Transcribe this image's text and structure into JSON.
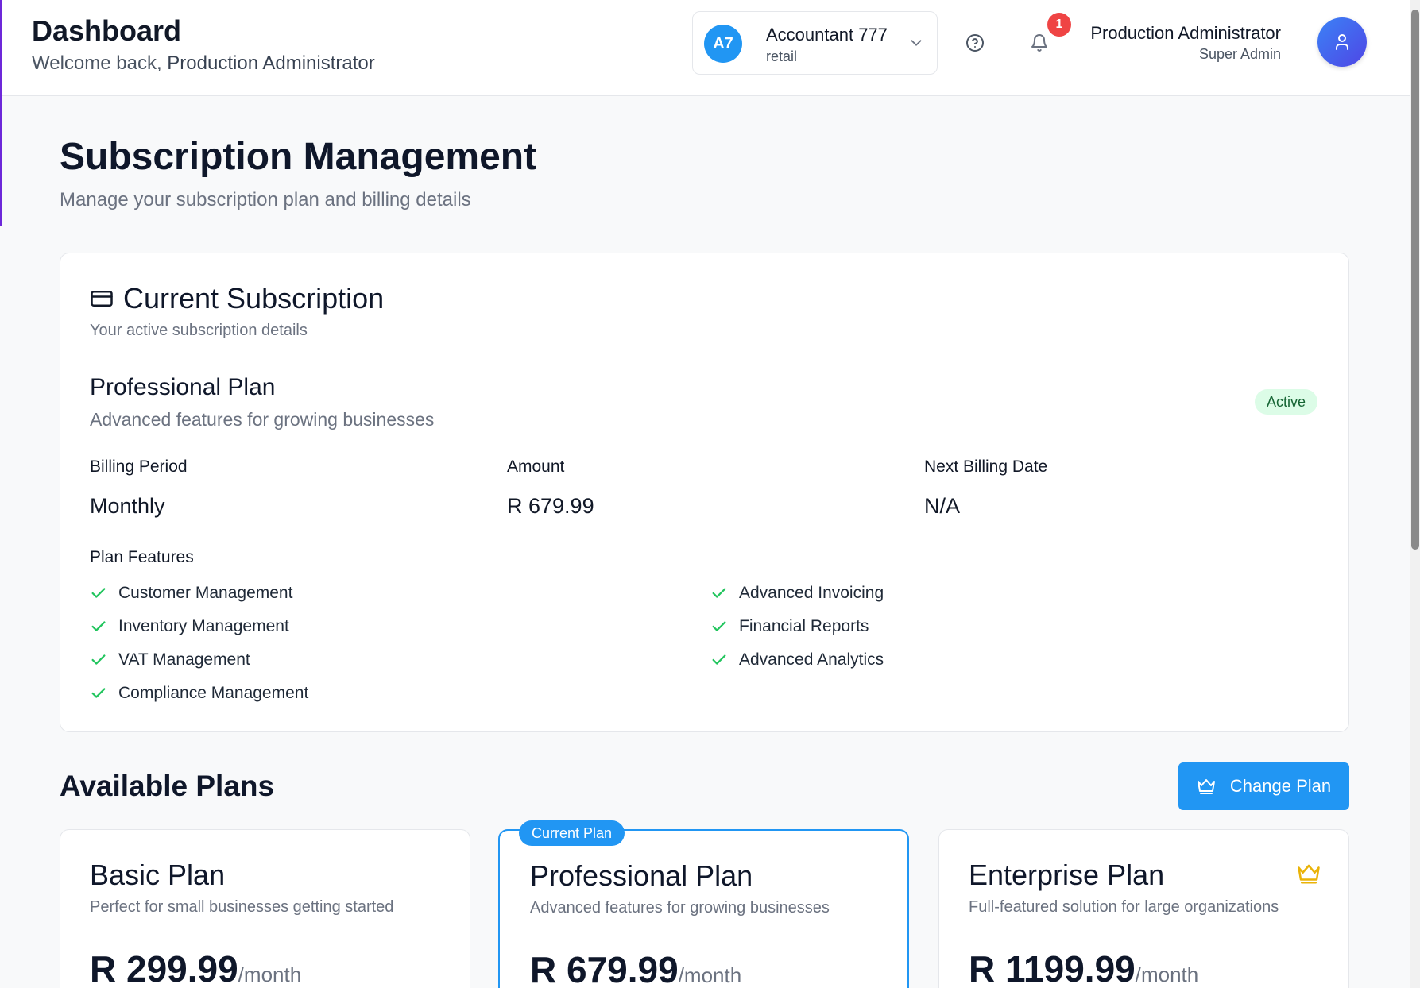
{
  "header": {
    "title": "Dashboard",
    "welcome_prefix": "Welcome back,",
    "welcome_name": "Production Administrator",
    "company": {
      "initials": "A7",
      "name": "Accountant 777",
      "type": "retail"
    },
    "notifications_count": "1",
    "user": {
      "name": "Production Administrator",
      "role": "Super Admin"
    }
  },
  "page": {
    "title": "Subscription Management",
    "subtitle": "Manage your subscription plan and billing details"
  },
  "current_subscription": {
    "title": "Current Subscription",
    "description": "Your active subscription details",
    "plan_name": "Professional Plan",
    "plan_description": "Advanced features for growing businesses",
    "status": "Active",
    "billing_period_label": "Billing Period",
    "billing_period_value": "Monthly",
    "amount_label": "Amount",
    "amount_value": "R 679.99",
    "next_billing_label": "Next Billing Date",
    "next_billing_value": "N/A",
    "features_label": "Plan Features",
    "features": [
      "Customer Management",
      "Inventory Management",
      "VAT Management",
      "Compliance Management",
      "Advanced Invoicing",
      "Financial Reports",
      "Advanced Analytics"
    ]
  },
  "available_plans": {
    "title": "Available Plans",
    "change_button": "Change Plan",
    "current_tag": "Current Plan",
    "plans": [
      {
        "name": "Basic Plan",
        "description": "Perfect for small businesses getting started",
        "price": "R 299.99",
        "period": "/month"
      },
      {
        "name": "Professional Plan",
        "description": "Advanced features for growing businesses",
        "price": "R 679.99",
        "period": "/month"
      },
      {
        "name": "Enterprise Plan",
        "description": "Full-featured solution for large organizations",
        "price": "R 1199.99",
        "period": "/month"
      }
    ]
  },
  "colors": {
    "primary": "#2196f3",
    "success": "#22c55e",
    "badge_red": "#ef4444",
    "crown_gold": "#eab308"
  },
  "icons": [
    "chevron-down-icon",
    "help-circle-icon",
    "bell-icon",
    "user-icon",
    "credit-card-icon",
    "check-icon",
    "crown-icon"
  ]
}
